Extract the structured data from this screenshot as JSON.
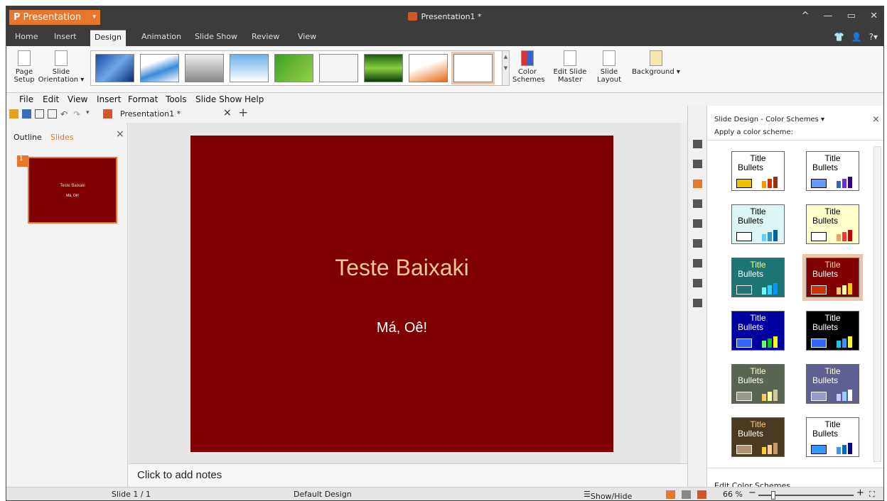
{
  "app": {
    "title": "Presentation",
    "document_title": "Presentation1 *"
  },
  "window_controls": {
    "expand": "^",
    "minimize": "—",
    "restore": "▭",
    "close": "✕"
  },
  "ribbon_tabs": [
    "Home",
    "Insert",
    "Design",
    "Animation",
    "Slide Show",
    "Review",
    "View"
  ],
  "ribbon": {
    "page_setup": "Page Setup",
    "slide_orientation": "Slide Orientation",
    "color_schemes": "Color Schemes",
    "edit_slide_master": "Edit Slide Master",
    "slide_layout": "Slide Layout",
    "background": "Background"
  },
  "menu": [
    "File",
    "Edit",
    "View",
    "Insert",
    "Format",
    "Tools",
    "Slide Show",
    "Help"
  ],
  "doc_tab": {
    "label": "Presentation1 *",
    "close": "×",
    "new": "+"
  },
  "left_pane": {
    "outline_tab": "Outline",
    "slides_tab": "Slides",
    "close": "×",
    "thumb_number": "1",
    "thumb_title": "Teste Baixaki",
    "thumb_subtitle": "Má, Oê!"
  },
  "slide": {
    "title": "Teste Baixaki",
    "subtitle": "Má, Oê!",
    "bg_color": "#7f0000"
  },
  "notes_placeholder": "Click to add notes",
  "right_pane": {
    "header": "Slide Design - Color Schemes",
    "close": "×",
    "subheader": "Apply a color scheme:",
    "footer": "Edit Color Schemes...",
    "scheme_title": "Title",
    "scheme_bullets": "Bullets",
    "schemes": [
      {
        "bg": "#ffffff",
        "title": "#000000",
        "text": "#000000",
        "shape": "#f2c200",
        "bars": [
          "#ff9900",
          "#cc3300",
          "#993300"
        ]
      },
      {
        "bg": "#ffffff",
        "title": "#000000",
        "text": "#000000",
        "shape": "#6699ff",
        "bars": [
          "#3366cc",
          "#6633cc",
          "#330099"
        ]
      },
      {
        "bg": "#ddf5f5",
        "title": "#000000",
        "text": "#000000",
        "shape": "#ffffff",
        "bars": [
          "#66ccff",
          "#3399cc",
          "#006699"
        ]
      },
      {
        "bg": "#ffffcc",
        "title": "#000000",
        "text": "#000000",
        "shape": "#ffffff",
        "bars": [
          "#ff9966",
          "#ff3333",
          "#cc0000"
        ]
      },
      {
        "bg": "#1d7472",
        "title": "#ffff66",
        "text": "#ffffff",
        "shape": "#1d7472",
        "bars": [
          "#66ffff",
          "#33ccff",
          "#0099ff"
        ]
      },
      {
        "bg": "#800000",
        "title": "#ffcc99",
        "text": "#ffffff",
        "shape": "#cc3300",
        "bars": [
          "#ffcc66",
          "#ffff99",
          "#ffcc00"
        ]
      },
      {
        "bg": "#0000a0",
        "title": "#ffffff",
        "text": "#ffffff",
        "shape": "#3366ff",
        "bars": [
          "#66ff66",
          "#00cc00",
          "#ffff00"
        ]
      },
      {
        "bg": "#000000",
        "title": "#ffffff",
        "text": "#ffffff",
        "shape": "#3366ff",
        "bars": [
          "#00ccff",
          "#3399ff",
          "#ffff00"
        ]
      },
      {
        "bg": "#5a6453",
        "title": "#ffffcc",
        "text": "#ffffff",
        "shape": "#999988",
        "bars": [
          "#ffcc66",
          "#ffff99",
          "#cccc99"
        ]
      },
      {
        "bg": "#5f5f93",
        "title": "#ffffcc",
        "text": "#ffffff",
        "shape": "#9999cc",
        "bars": [
          "#ccccff",
          "#99ccff",
          "#ffffff"
        ]
      },
      {
        "bg": "#4a3a22",
        "title": "#ffcc66",
        "text": "#ffffff",
        "shape": "#b09070",
        "bars": [
          "#ffcc33",
          "#ffcc99",
          "#cc9966"
        ]
      },
      {
        "bg": "#ffffff",
        "title": "#000000",
        "text": "#000000",
        "shape": "#3399ff",
        "bars": [
          "#3399ff",
          "#0066cc",
          "#000099"
        ]
      }
    ]
  },
  "status": {
    "slide": "Slide 1 / 1",
    "design": "Default Design",
    "notes_toggle": "Show/Hide Note",
    "zoom": "66 %",
    "zoom_level_pct": 66
  }
}
